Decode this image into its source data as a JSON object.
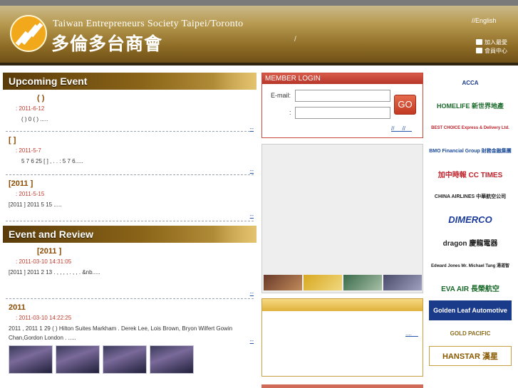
{
  "header": {
    "org_name_en": "Taiwan Entrepreneurs Society Taipei/Toronto",
    "org_name_zh": "多倫多台商會",
    "lang_link": "//English",
    "top_links": "/",
    "util_links": [
      "加入最愛",
      "會員中心"
    ]
  },
  "upcoming": {
    "heading": "Upcoming Event",
    "items": [
      {
        "title": "(  )",
        "date": ": 2011-6-12",
        "summary": "(  )  0  (  )  .....",
        "more": "--"
      },
      {
        "title": "[  ]",
        "date": ": 2011-5-7",
        "summary": "5 7  6 25  [  ]  ,  .  . : 5 7 6.....",
        "more": "--"
      },
      {
        "title": "[2011  ]",
        "date": ": 2011-5-15",
        "summary": "[2011  ]  2011 5 15  .....",
        "more": "--"
      }
    ]
  },
  "review": {
    "heading": "Event and Review",
    "items": [
      {
        "title": "[2011  ]",
        "date": ": 2011-03-10 14:31:05",
        "summary": "[2011  ]  2011 2 13  .  ,  ,  ,  ,  .  ,  ,  . &nb.....",
        "more": "--"
      },
      {
        "title": "2011",
        "date": ": 2011-03-10 14:22:25",
        "summary": "2011  , 2011 1 29 (  ) Hilton Suites Markham  .  Derek Lee, Lois Brown, Bryon Wilfert  Gowin Chan,Gordon London  . .....",
        "more": "--"
      }
    ]
  },
  "login": {
    "heading": "MEMBER LOGIN",
    "email_label": "E-mail:",
    "password_label": ":",
    "go_label": "GO",
    "links": "//__  //__"
  },
  "info_box": {
    "more": "....__"
  },
  "sponsors": [
    {
      "label": "ACCA",
      "color": "#1a3a8a"
    },
    {
      "label": "HOMELIFE 新世界地產",
      "color": "#1a6a2a"
    },
    {
      "label": "BEST CHOICE Express & Delivery Ltd.",
      "color": "#c0202a"
    },
    {
      "label": "BMO Financial Group 財務金融集團",
      "color": "#1a4a9a"
    },
    {
      "label": "加中時報 CC TIMES",
      "color": "#c0202a"
    },
    {
      "label": "CHINA AIRLINES 中華航空公司",
      "color": "#222222"
    },
    {
      "label": "DIMERCO",
      "color": "#1a3a9a"
    },
    {
      "label": "dragon 慶龍電器",
      "color": "#222222"
    },
    {
      "label": "Edward Jones Mr. Michael Tang 湯道智",
      "color": "#1a1a1a"
    },
    {
      "label": "EVA AIR 長榮航空",
      "color": "#1a6a2a"
    },
    {
      "label": "Golden Leaf Automotive",
      "color": "#ffffff"
    },
    {
      "label": "GOLD PACIFIC",
      "color": "#8a6a1a"
    },
    {
      "label": "HANSTAR 漢星",
      "color": "#8a5a00"
    }
  ]
}
